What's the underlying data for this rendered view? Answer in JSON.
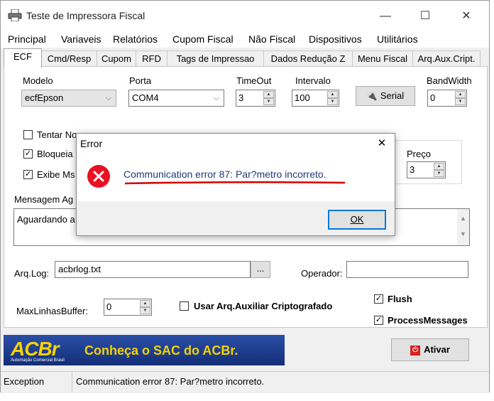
{
  "window": {
    "title": "Teste de Impressora Fiscal",
    "minimize": "—",
    "maximize": "☐",
    "close": "✕"
  },
  "menu": [
    "Principal",
    "Variaveis",
    "Relatórios",
    "Cupom Fiscal",
    "Não Fiscal",
    "Dispositivos",
    "Utilitários"
  ],
  "tabs": [
    "ECF",
    "Cmd/Resp",
    "Cupom",
    "RFD",
    "Tags de Impressao",
    "Dados Redução Z",
    "Menu Fiscal",
    "Arq.Aux.Cript."
  ],
  "ecf": {
    "modelo_label": "Modelo",
    "modelo_value": "ecfEpson",
    "porta_label": "Porta",
    "porta_value": "COM4",
    "timeout_label": "TimeOut",
    "timeout_value": "3",
    "intervalo_label": "Intervalo",
    "intervalo_value": "100",
    "serial_button": "Serial",
    "bandwidth_label": "BandWidth",
    "bandwidth_value": "0",
    "check_tentar": "Tentar No",
    "check_bloqueia": "Bloqueia",
    "check_exibe": "Exibe Ms",
    "preco_label": "Preço",
    "preco_value": "3",
    "mensagem_label": "Mensagem Ag",
    "mensagem_value": "Aguardando a",
    "arqlog_label": "Arq.Log:",
    "arqlog_value": "acbrlog.txt",
    "browse_button": "...",
    "operador_label": "Operador:",
    "operador_value": "",
    "maxlinhas_label": "MaxLinhasBuffer:",
    "maxlinhas_value": "0",
    "usar_arq_label": "Usar Arq.Auxiliar Criptografado",
    "flush_label": "Flush",
    "process_label": "ProcessMessages"
  },
  "banner": {
    "logo_text": "ACBr",
    "logo_sub": "Automação Comercial Brasil",
    "message": "Conheça o SAC do ACBr.",
    "ativar_button": "Ativar"
  },
  "status": {
    "left": "Exception",
    "right": "Communication error 87: Par?metro incorreto."
  },
  "dialog": {
    "title": "Error",
    "close": "✕",
    "message": "Communication error 87: Par?metro incorreto.",
    "ok_button": "OK"
  },
  "colors": {
    "error_red": "#e81123",
    "underline_red": "#d40000",
    "banner_blue": "#1e3c8c",
    "banner_text": "#f5d200"
  }
}
